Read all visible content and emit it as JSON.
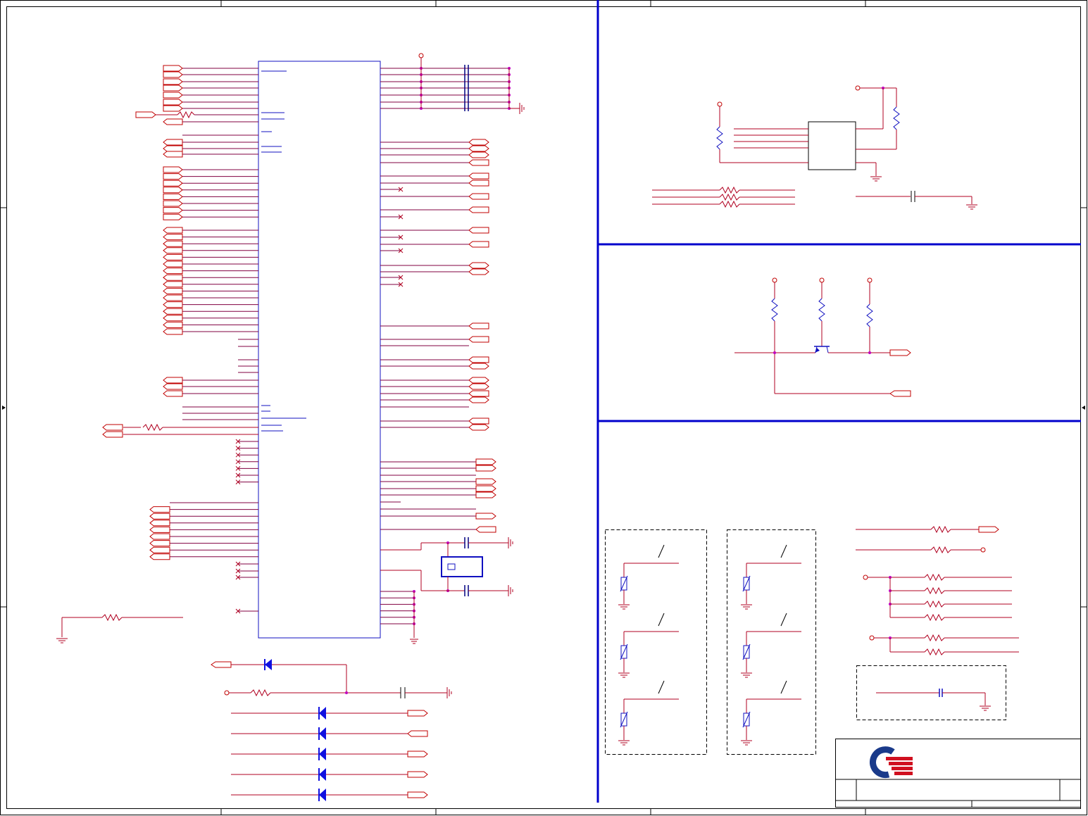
{
  "sheet": {
    "border_color": "#000000",
    "wire_color": "#b00020",
    "divider_color": "#0000cc",
    "component_color": "#1010c0",
    "junction_color": "#c000c0"
  },
  "title_block": {
    "logo": "company-logo"
  }
}
